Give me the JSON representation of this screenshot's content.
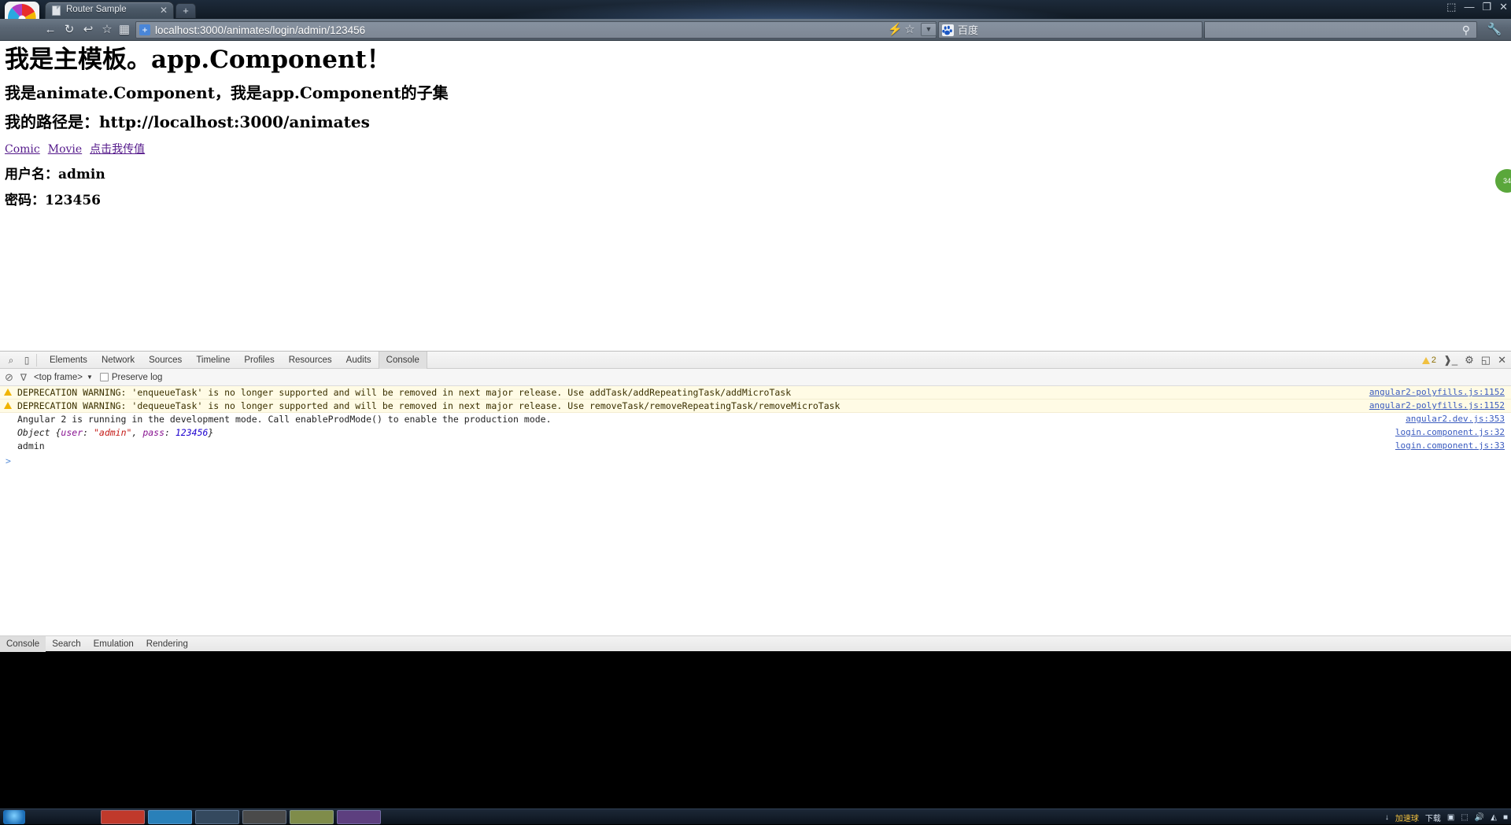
{
  "browser": {
    "tab": {
      "title": "Router Sample",
      "close_label": "✕",
      "favicon": "document-icon"
    },
    "new_tab_label": "+",
    "window_controls": {
      "minimize": "—",
      "maximize": "❐",
      "close": "✕",
      "extra": "⬚"
    },
    "nav": {
      "back": "←",
      "reload": "↻",
      "undo": "↩",
      "bookmark": "☆",
      "apps": "▦"
    },
    "omnibox": {
      "url": "localhost:3000/animates/login/admin/123456",
      "scheme_badge": "+",
      "flash": "⚡",
      "star": "☆",
      "dropdown": "▼"
    },
    "search": {
      "engine_label": "百度",
      "engine_icon": "baidu-paw-icon",
      "placeholder": "",
      "value": "",
      "go_icon": "⚲"
    },
    "wrench": "🔧"
  },
  "page": {
    "heading": "我是主模板。app.Component！",
    "subheading": "我是animate.Component，我是app.Component的子集",
    "path_line": "我的路径是：http://localhost:3000/animates",
    "links": [
      {
        "label": "Comic"
      },
      {
        "label": "Movie"
      },
      {
        "label": "点击我传值"
      }
    ],
    "username_line": "用户名：admin",
    "password_line": "密码：123456",
    "side_badge": "34"
  },
  "devtools": {
    "tool_icons": {
      "inspect": "⌕",
      "device": "▯"
    },
    "tabs": [
      {
        "label": "Elements",
        "active": false
      },
      {
        "label": "Network",
        "active": false
      },
      {
        "label": "Sources",
        "active": false
      },
      {
        "label": "Timeline",
        "active": false
      },
      {
        "label": "Profiles",
        "active": false
      },
      {
        "label": "Resources",
        "active": false
      },
      {
        "label": "Audits",
        "active": false
      },
      {
        "label": "Console",
        "active": true
      }
    ],
    "warning_count": "2",
    "right_icons": {
      "console_toggle": "❱_",
      "settings": "⚙",
      "dock": "◱",
      "close": "✕"
    },
    "filter_bar": {
      "clear_icon": "⊘",
      "filter_icon": "∇",
      "frame_label": "<top frame>",
      "frame_caret": "▼",
      "preserve_log_label": "Preserve log",
      "preserve_log_checked": false
    },
    "console_rows": [
      {
        "level": "warning",
        "text": "DEPRECATION WARNING: 'enqueueTask' is no longer supported and will be removed in next major release. Use addTask/addRepeatingTask/addMicroTask",
        "source": "angular2-polyfills.js:1152"
      },
      {
        "level": "warning",
        "text": "DEPRECATION WARNING: 'dequeueTask' is no longer supported and will be removed in next major release. Use removeTask/removeRepeatingTask/removeMicroTask",
        "source": "angular2-polyfills.js:1152"
      },
      {
        "level": "log",
        "text": "Angular 2 is running in the development mode. Call enableProdMode() to enable the production mode.",
        "source": "angular2.dev.js:353"
      },
      {
        "level": "object",
        "object_name": "Object",
        "object_text": "{user: \"admin\", pass: 123456}",
        "object_parts": {
          "open": "{",
          "key1": "user",
          "sep1": ": ",
          "val1": "\"admin\"",
          "comma": ", ",
          "key2": "pass",
          "sep2": ": ",
          "val2": "123456",
          "close": "}"
        },
        "source": "login.component.js:32"
      },
      {
        "level": "log",
        "text": "admin",
        "source": "login.component.js:33"
      }
    ],
    "prompt_caret": ">",
    "drawer_tabs": [
      {
        "label": "Console",
        "active": true
      },
      {
        "label": "Search",
        "active": false
      },
      {
        "label": "Emulation",
        "active": false
      },
      {
        "label": "Rendering",
        "active": false
      }
    ]
  },
  "taskbar": {
    "tray_text_1": "加速球",
    "tray_text_2": "下载",
    "tray_icons": [
      "↓",
      "▣",
      "⬚",
      "🔊",
      "◭",
      "■"
    ]
  },
  "colors": {
    "warning_bg": "#fffbe5",
    "link": "#551a8b",
    "source_link": "#3a5bbf",
    "accent_blue": "#4a86d8"
  }
}
